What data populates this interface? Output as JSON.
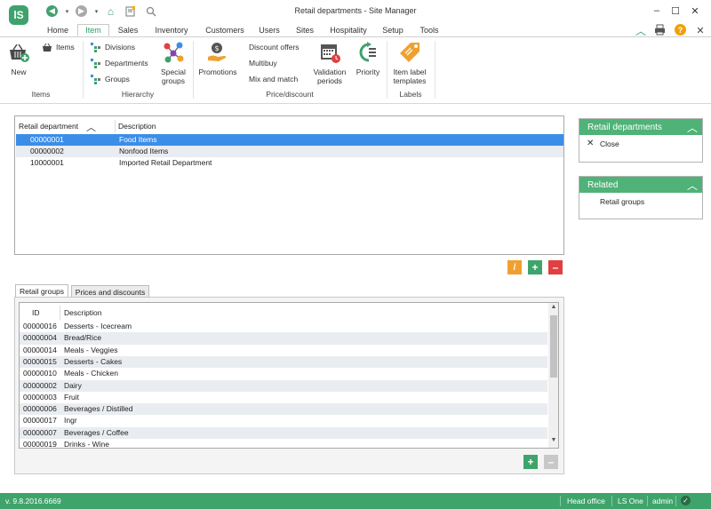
{
  "window": {
    "title": "Retail departments - Site Manager",
    "logo_text": "lS",
    "minimize": "–",
    "maximize": "☐",
    "close": "✕"
  },
  "ribbon_tabs": [
    "Home",
    "Item",
    "Sales",
    "Inventory",
    "Customers",
    "Users",
    "Sites",
    "Hospitality",
    "Setup",
    "Tools"
  ],
  "ribbon": {
    "items_group": {
      "label": "Items",
      "new_label": "New",
      "items_label": "Items"
    },
    "hierarchy_group": {
      "label": "Hierarchy",
      "divisions": "Divisions",
      "departments": "Departments",
      "groups": "Groups",
      "special_groups": "Special groups"
    },
    "price_group": {
      "label": "Price/discount",
      "promotions": "Promotions",
      "discount_offers": "Discount offers",
      "multibuy": "Multibuy",
      "mix_and_match": "Mix and match",
      "validation_periods": "Validation periods",
      "priority": "Priority"
    },
    "labels_group": {
      "label": "Labels",
      "item_label_templates": "Item label templates"
    }
  },
  "departments_grid": {
    "columns": [
      "Retail department",
      "Description"
    ],
    "rows": [
      {
        "id": "00000001",
        "description": "Food Items"
      },
      {
        "id": "00000002",
        "description": "Nonfood Items"
      },
      {
        "id": "10000001",
        "description": "Imported Retail Department"
      }
    ]
  },
  "action_buttons": {
    "edit": "/",
    "add": "+",
    "delete": "–"
  },
  "bottom_tabs": [
    "Retail groups",
    "Prices and discounts"
  ],
  "groups_grid": {
    "columns": [
      "ID",
      "Description"
    ],
    "rows": [
      {
        "id": "00000016",
        "description": "Desserts - Icecream"
      },
      {
        "id": "00000004",
        "description": "Bread/Rice"
      },
      {
        "id": "00000014",
        "description": "Meals - Veggies"
      },
      {
        "id": "00000015",
        "description": "Desserts - Cakes"
      },
      {
        "id": "00000010",
        "description": "Meals - Chicken"
      },
      {
        "id": "00000002",
        "description": "Dairy"
      },
      {
        "id": "00000003",
        "description": "Fruit"
      },
      {
        "id": "00000006",
        "description": "Beverages / Distilled"
      },
      {
        "id": "00000017",
        "description": "Ingr"
      },
      {
        "id": "00000007",
        "description": "Beverages / Coffee"
      },
      {
        "id": "00000019",
        "description": "Drinks - Wine"
      }
    ]
  },
  "side_panels": {
    "retail_departments": {
      "title": "Retail departments",
      "close_label": "Close"
    },
    "related": {
      "title": "Related",
      "retail_groups_label": "Retail groups"
    }
  },
  "statusbar": {
    "version": "v. 9.8.2016.6669",
    "store": "Head office",
    "product": "LS One",
    "user": "admin"
  },
  "colors": {
    "accent_green": "#3fa46b",
    "selection_blue": "#3b8ee8",
    "edit_orange": "#f0a030",
    "delete_red": "#e04040"
  }
}
